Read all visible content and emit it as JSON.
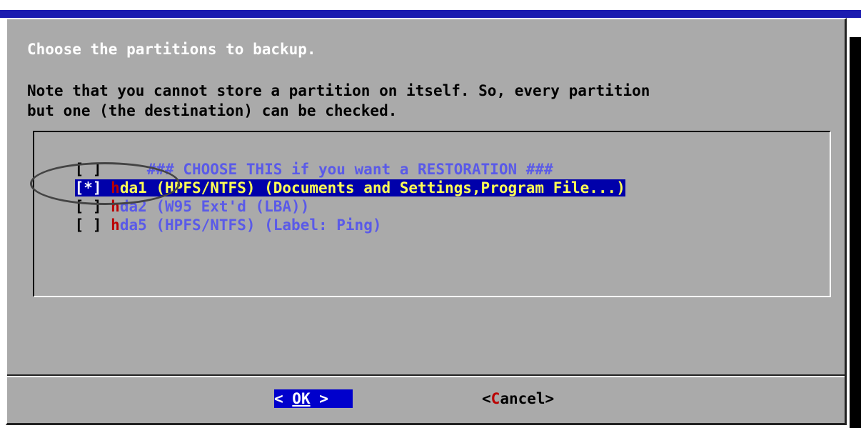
{
  "dialog": {
    "prompt": "Choose the partitions to backup.",
    "note_line1": "Note that you cannot store a partition on itself. So, every partition",
    "note_line2": "but one (the destination) can be checked."
  },
  "list": {
    "items": [
      {
        "checkbox": "[ ]",
        "hotkey": "",
        "label": "    ### CHOOSE THIS if you want a RESTORATION ###",
        "selected": false
      },
      {
        "checkbox": "[*]",
        "hotkey": "h",
        "label": "da1 (HPFS/NTFS) (Documents and Settings,Program File...)",
        "selected": true
      },
      {
        "checkbox": "[ ]",
        "hotkey": "h",
        "label": "da2 (W95 Ext'd (LBA))",
        "selected": false
      },
      {
        "checkbox": "[ ]",
        "hotkey": "h",
        "label": "da5 (HPFS/NTFS) (Label: Ping)",
        "selected": false
      }
    ]
  },
  "buttons": {
    "ok": {
      "left": "< ",
      "key": "OK",
      "right": " >"
    },
    "cancel": {
      "left": "<",
      "key": "C",
      "right": "ancel>"
    }
  },
  "colors": {
    "dialog_bg": "#aaaaaa",
    "selection_bg": "#0000aa",
    "hotkey": "#bb0000",
    "item_text": "#5a5ae8",
    "selected_text": "#ffff55"
  }
}
